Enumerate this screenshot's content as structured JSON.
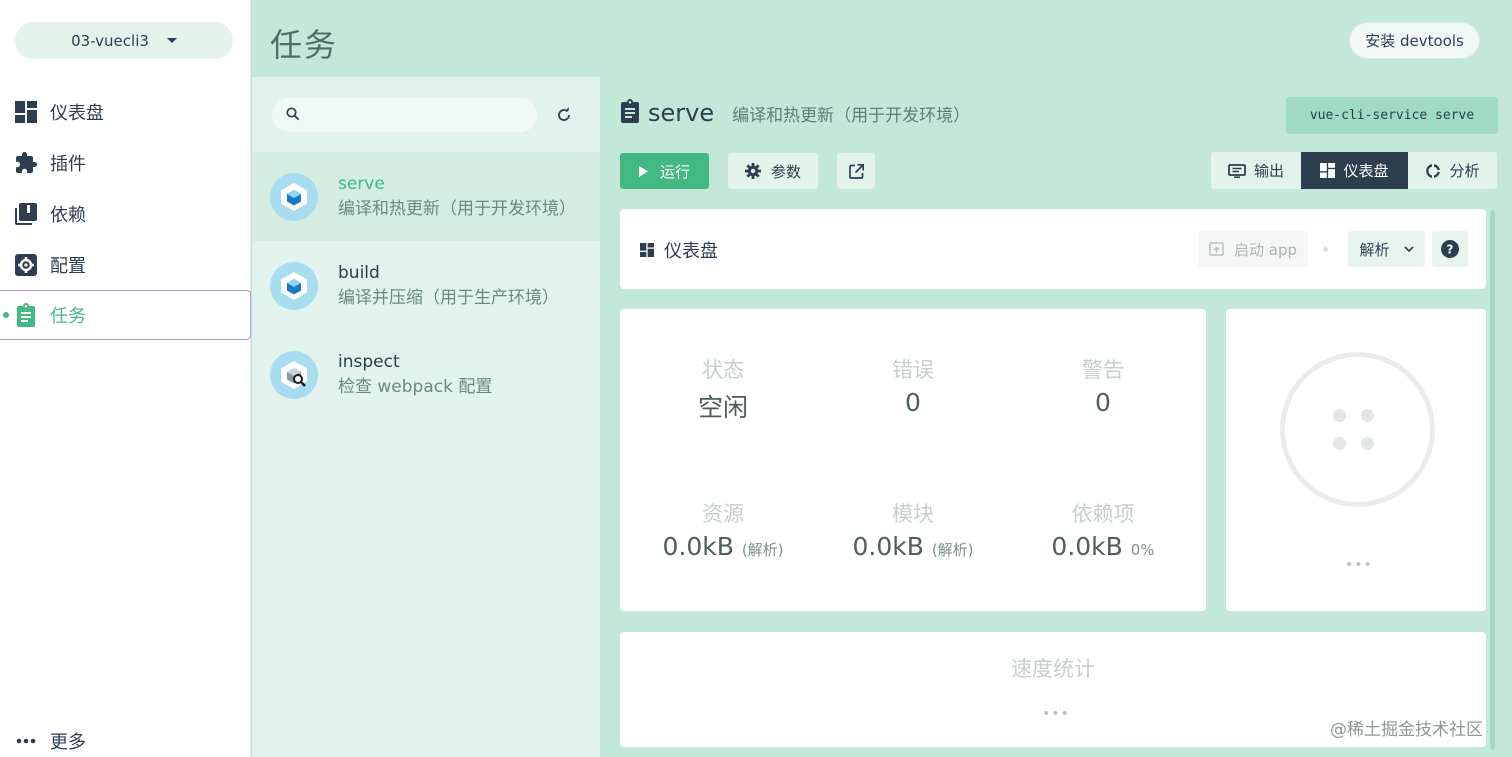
{
  "sidebar": {
    "project_name": "03-vuecli3",
    "items": [
      {
        "label": "仪表盘",
        "icon": "dashboard-icon"
      },
      {
        "label": "插件",
        "icon": "puzzle-icon"
      },
      {
        "label": "依赖",
        "icon": "library-icon"
      },
      {
        "label": "配置",
        "icon": "settings-icon"
      },
      {
        "label": "任务",
        "icon": "clipboard-icon"
      }
    ],
    "active_index": 4,
    "more_label": "更多"
  },
  "header": {
    "title": "任务",
    "devtools_label": "安装 devtools"
  },
  "tasks": {
    "search_placeholder": "",
    "items": [
      {
        "name": "serve",
        "description": "编译和热更新（用于开发环境）"
      },
      {
        "name": "build",
        "description": "编译并压缩（用于生产环境）"
      },
      {
        "name": "inspect",
        "description": "检查 webpack 配置"
      }
    ],
    "selected_index": 0
  },
  "task_detail": {
    "name": "serve",
    "description": "编译和热更新（用于开发环境）",
    "command": "vue-cli-service serve",
    "run_label": "运行",
    "params_label": "参数",
    "view_tabs": [
      {
        "label": "输出",
        "icon": "terminal-icon"
      },
      {
        "label": "仪表盘",
        "icon": "dashboard-icon"
      },
      {
        "label": "分析",
        "icon": "donut-icon"
      }
    ],
    "active_view": 1
  },
  "dashboard": {
    "title": "仪表盘",
    "start_app_label": "启动 app",
    "analyze_label": "解析",
    "stats": {
      "status_label": "状态",
      "status_value": "空闲",
      "errors_label": "错误",
      "errors_value": "0",
      "warnings_label": "警告",
      "warnings_value": "0",
      "assets_label": "资源",
      "assets_value": "0.0kB",
      "assets_note": "(解析)",
      "modules_label": "模块",
      "modules_value": "0.0kB",
      "modules_note": "(解析)",
      "deps_label": "依赖项",
      "deps_value": "0.0kB",
      "deps_note": "0%"
    },
    "status_ellipsis": "•••",
    "speed_title": "速度统计",
    "speed_ellipsis": "•••"
  },
  "watermark": "@稀土掘金技术社区",
  "colors": {
    "accent": "#42b983",
    "dark": "#2c3e50",
    "header_bg": "#c3e8d9",
    "panel_bg": "#e1f3ec",
    "active_outline": "#b497d8"
  }
}
